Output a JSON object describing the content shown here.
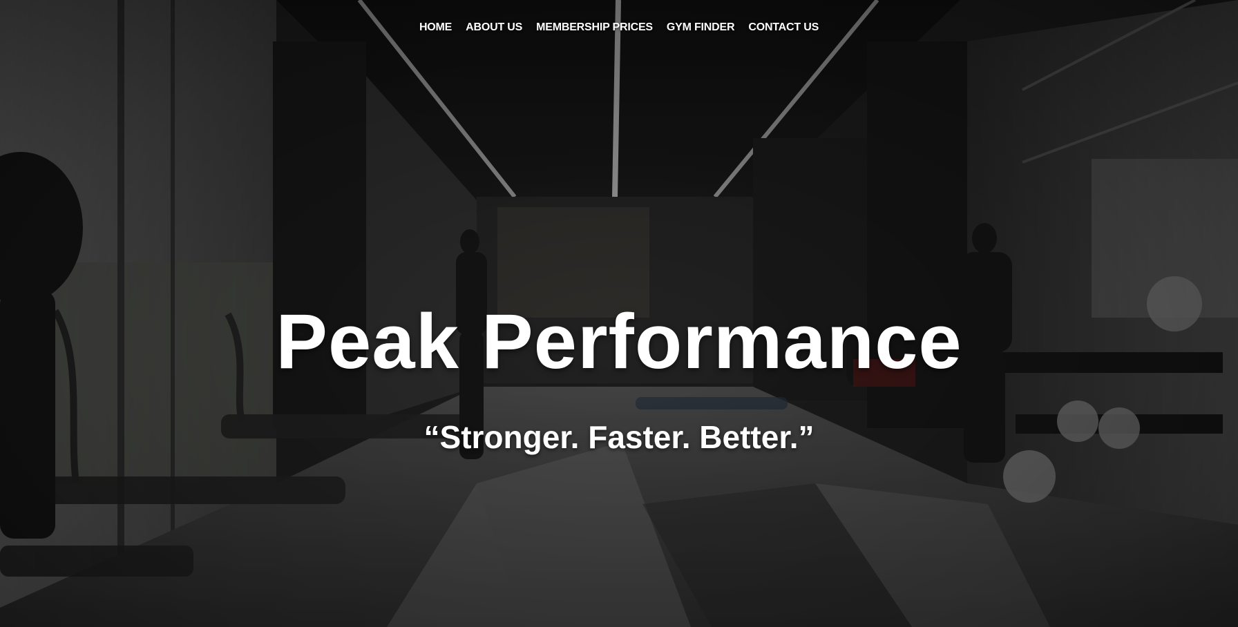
{
  "nav": {
    "items": [
      {
        "label": "HOME"
      },
      {
        "label": "ABOUT US"
      },
      {
        "label": "MEMBERSHIP PRICES"
      },
      {
        "label": "GYM FINDER"
      },
      {
        "label": "CONTACT US"
      }
    ]
  },
  "hero": {
    "title": "Peak Performance",
    "tagline": "“Stronger. Faster. Better.”"
  },
  "colors": {
    "text": "#ffffff",
    "background_dark": "#1a1a1a",
    "floor_light": "#8a8a8a"
  }
}
